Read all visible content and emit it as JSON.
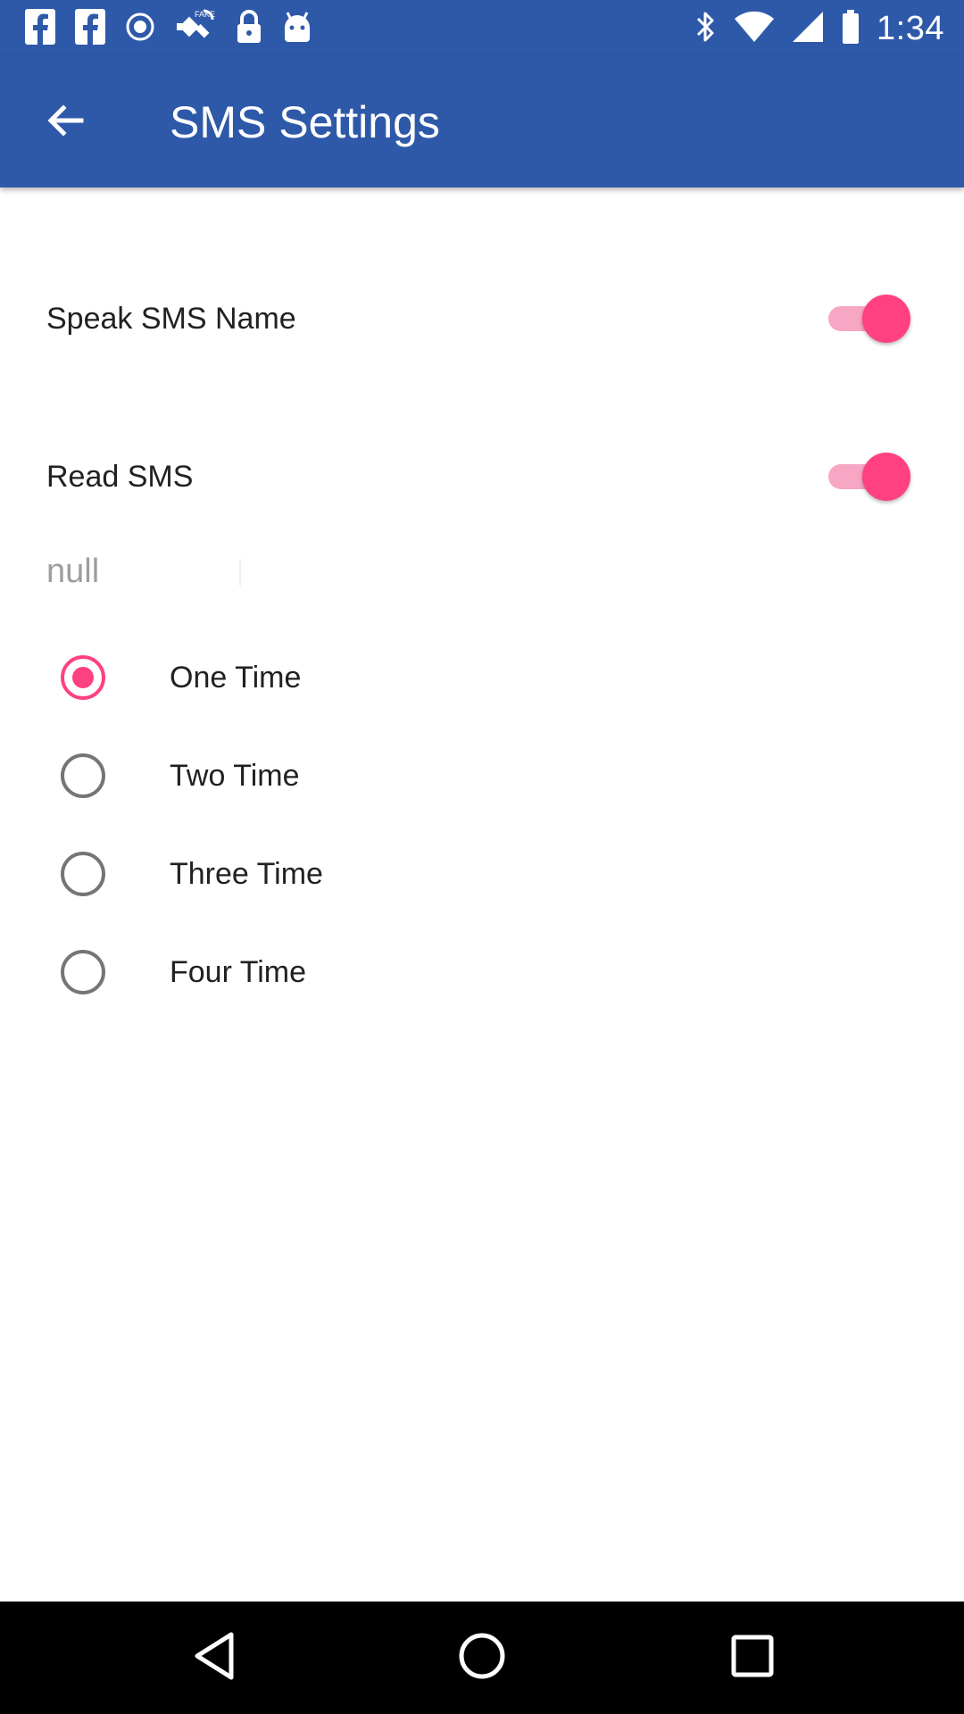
{
  "status_bar": {
    "time": "1:34",
    "left_icons": [
      "facebook-icon",
      "facebook-icon",
      "record-icon",
      "fake-gps-icon",
      "lock-icon",
      "android-icon"
    ],
    "right_icons": [
      "bluetooth-icon",
      "wifi-icon",
      "signal-icon",
      "battery-icon"
    ]
  },
  "app_bar": {
    "title": "SMS Settings",
    "back_icon": "arrow-back-icon"
  },
  "settings": {
    "speak_sms_name": {
      "label": "Speak SMS Name",
      "enabled": true
    },
    "read_sms": {
      "label": "Read SMS",
      "enabled": true
    }
  },
  "repeat_field": {
    "value": "null"
  },
  "repeat_options": [
    {
      "label": "One Time",
      "selected": true
    },
    {
      "label": "Two Time",
      "selected": false
    },
    {
      "label": "Three Time",
      "selected": false
    },
    {
      "label": "Four Time",
      "selected": false
    }
  ],
  "nav_bar": {
    "buttons": [
      "back-triangle-icon",
      "home-circle-icon",
      "recents-square-icon"
    ]
  },
  "colors": {
    "primary": "#2e59a9",
    "accent": "#ff4081",
    "switch_track": "#f7a6c3",
    "text": "#212121",
    "hint": "#9e9e9e",
    "nav_bar": "#000000"
  }
}
